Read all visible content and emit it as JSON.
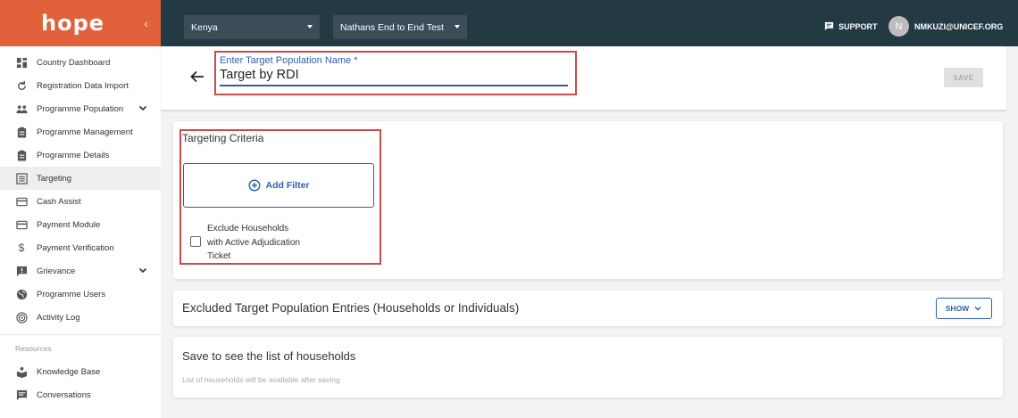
{
  "brand": {
    "logo_text": "hope",
    "accent": "#e1613a",
    "topbar_color": "#233944",
    "link_color": "#2f5fa5",
    "highlight_color": "#c94b4b"
  },
  "topbar": {
    "country": "Kenya",
    "programme": "Nathans End to End Test",
    "support_label": "SUPPORT",
    "avatar_initial": "N",
    "user_email": "NMKUZI@UNICEF.ORG"
  },
  "sidebar": {
    "items": [
      {
        "label": "Country Dashboard",
        "icon": "dashboard-icon"
      },
      {
        "label": "Registration Data Import",
        "icon": "refresh-icon"
      },
      {
        "label": "Programme Population",
        "icon": "people-icon",
        "expandable": true
      },
      {
        "label": "Programme Management",
        "icon": "clipboard-icon"
      },
      {
        "label": "Programme Details",
        "icon": "clipboard-icon"
      },
      {
        "label": "Targeting",
        "icon": "list-icon",
        "active": true
      },
      {
        "label": "Cash Assist",
        "icon": "card-icon"
      },
      {
        "label": "Payment Module",
        "icon": "card-icon"
      },
      {
        "label": "Payment Verification",
        "icon": "dollar-icon"
      },
      {
        "label": "Grievance",
        "icon": "feedback-icon",
        "expandable": true
      },
      {
        "label": "Programme Users",
        "icon": "globe-icon"
      },
      {
        "label": "Activity Log",
        "icon": "target-icon"
      }
    ],
    "resources_label": "Resources",
    "resources": [
      {
        "label": "Knowledge Base",
        "icon": "book-icon"
      },
      {
        "label": "Conversations",
        "icon": "chat-icon"
      }
    ]
  },
  "header": {
    "field_label": "Enter Target Population Name *",
    "field_value": "Target by RDI",
    "save_label": "SAVE"
  },
  "criteria": {
    "title": "Targeting Criteria",
    "add_filter_label": "Add Filter",
    "exclude_label": "Exclude Households with Active Adjudication Ticket"
  },
  "excluded": {
    "title": "Excluded Target Population Entries (Households or Individuals)",
    "show_label": "SHOW"
  },
  "households": {
    "title": "Save to see the list of households",
    "subtitle": "List of households will be available after saving"
  }
}
